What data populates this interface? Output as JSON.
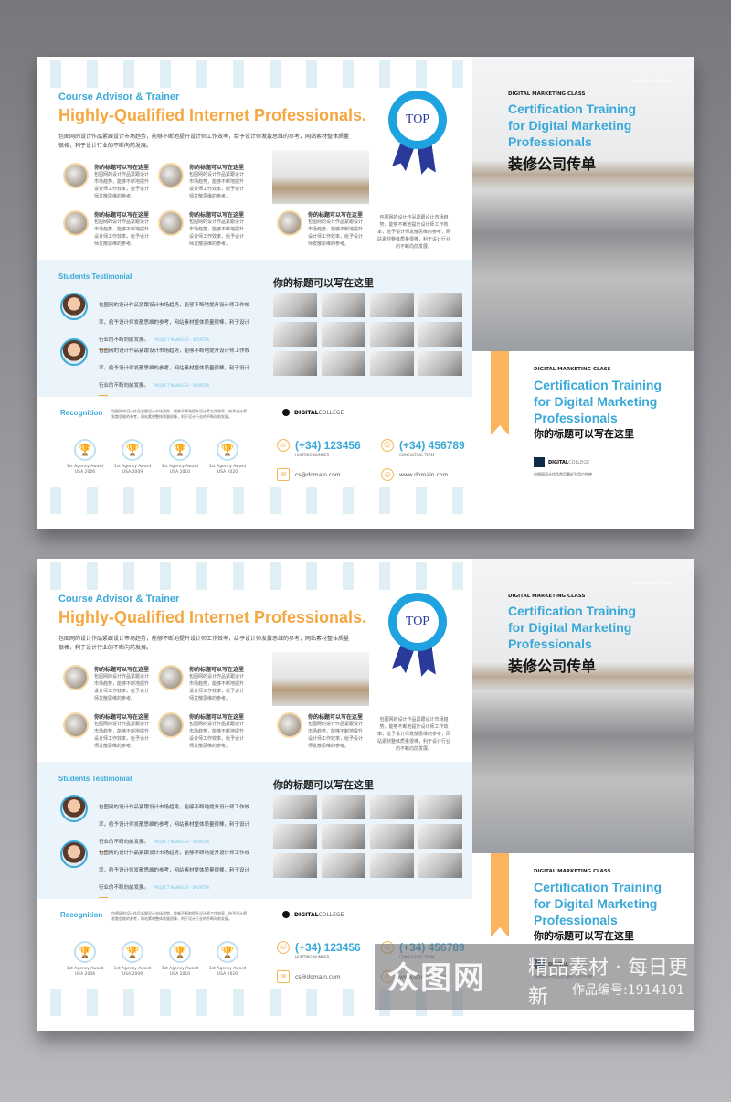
{
  "brochure": {
    "subtitle": "Course Advisor & Trainer",
    "headline": "Highly-Qualified Internet Professionals.",
    "intro": "包图网的设计作品紧跟设计市场趋势，能够不断地提升设计师工作效率，给予设计师发散思维的参考，网站素材整体质量很棒，利于设计行业的不断向前发展。",
    "features": [
      {
        "title": "你的标题可以写在这里",
        "text": "包图网的设计作品紧跟设计市场趋势，能够不断地提升设计师工作效率，给予设计师发散思维的参考。"
      },
      {
        "title": "你的标题可以写在这里",
        "text": "包图网的设计作品紧跟设计市场趋势，能够不断地提升设计师工作效率，给予设计师发散思维的参考。"
      },
      {
        "title": "你的标题可以写在这里",
        "text": "包图网的设计作品紧跟设计市场趋势，能够不断地提升设计师工作效率，给予设计师发散思维的参考。"
      },
      {
        "title": "你的标题可以写在这里",
        "text": "包图网的设计作品紧跟设计市场趋势，能够不断地提升设计师工作效率，给予设计师发散思维的参考。"
      },
      {
        "title": "你的标题可以写在这里",
        "text": "包图网的设计作品紧跟设计市场趋势，能够不断地提升设计师工作效率，给予设计师发散思维的参考。"
      }
    ],
    "side_text": "包图网的设计作品紧跟设计市场趋势，能够不断地提升设计师工作效率，给予设计师发散思维的参考，网站素材整体质量很棒，利于设计行业的不断向前发展。",
    "badge": {
      "text": "TOP",
      "color": "#1ea3e0",
      "ribbon_color": "#2a3a9a"
    },
    "testimonial": {
      "heading": "Students Testimonial",
      "items": [
        {
          "text": "包图网的设计作品紧跟设计市场趋势，能够不断地提升设计师工作效率，给予设计师发散思维的参考，网站素材整体质量很棒，利于设计行业的不断向前发展。",
          "role": "PROJECT MANAGER · SPORTSA"
        },
        {
          "text": "包图网的设计作品紧跟设计市场趋势，能够不断地提升设计师工作效率，给予设计师发散思维的参考，网站素材整体质量很棒，利于设计行业的不断向前发展。",
          "role": "PROJECT MANAGER · SPORTSA"
        }
      ]
    },
    "gallery_title": "你的标题可以写在这里",
    "recognition": {
      "heading": "Recognition",
      "text": "包图网的设计作品紧跟设计市场趋势，能够不断地提升设计师工作效率，给予设计师发散思维的参考，网站素材整体质量很棒，利于设计行业的不断向前发展。",
      "awards": [
        {
          "name": "1st Agency Award",
          "place": "USA 2006"
        },
        {
          "name": "1st Agency Award",
          "place": "USA 2009"
        },
        {
          "name": "1st Agency Award",
          "place": "USA 2010"
        },
        {
          "name": "1st Agency Award",
          "place": "USA 2020"
        }
      ]
    },
    "logo": {
      "bold": "DIGITAL",
      "light": "COLLEGE"
    },
    "contact": {
      "phone1": "(+34) 123456",
      "phone1_label": "HUNTING NUMBER",
      "phone2": "(+34) 456789",
      "phone2_label": "CONSULTING TEAM",
      "email": "cs@domain.com",
      "web": "www.domain.com"
    },
    "cover": {
      "website": "www.domain.com",
      "kicker": "DIGITAL MARKETING CLASS",
      "title_lines": [
        "Certification Training",
        "for Digital Marketing",
        "Professionals"
      ],
      "cn_title": "装修公司传单"
    },
    "back": {
      "kicker": "DIGITAL MARKETING CLASS",
      "title_lines": [
        "Certification Training",
        "for Digital Marketing",
        "Professionals"
      ],
      "cn_title": "你的标题可以写在这里",
      "tagline": "包图网设计作品首页最好为用户所使"
    },
    "colors": {
      "blue": "#3aa8d8",
      "orange": "#f5a742",
      "band": "#eaf4fa"
    }
  },
  "watermark": {
    "brand": "众图网",
    "slogan": "精品素材 · 每日更新",
    "id": "作品编号:1914101"
  }
}
